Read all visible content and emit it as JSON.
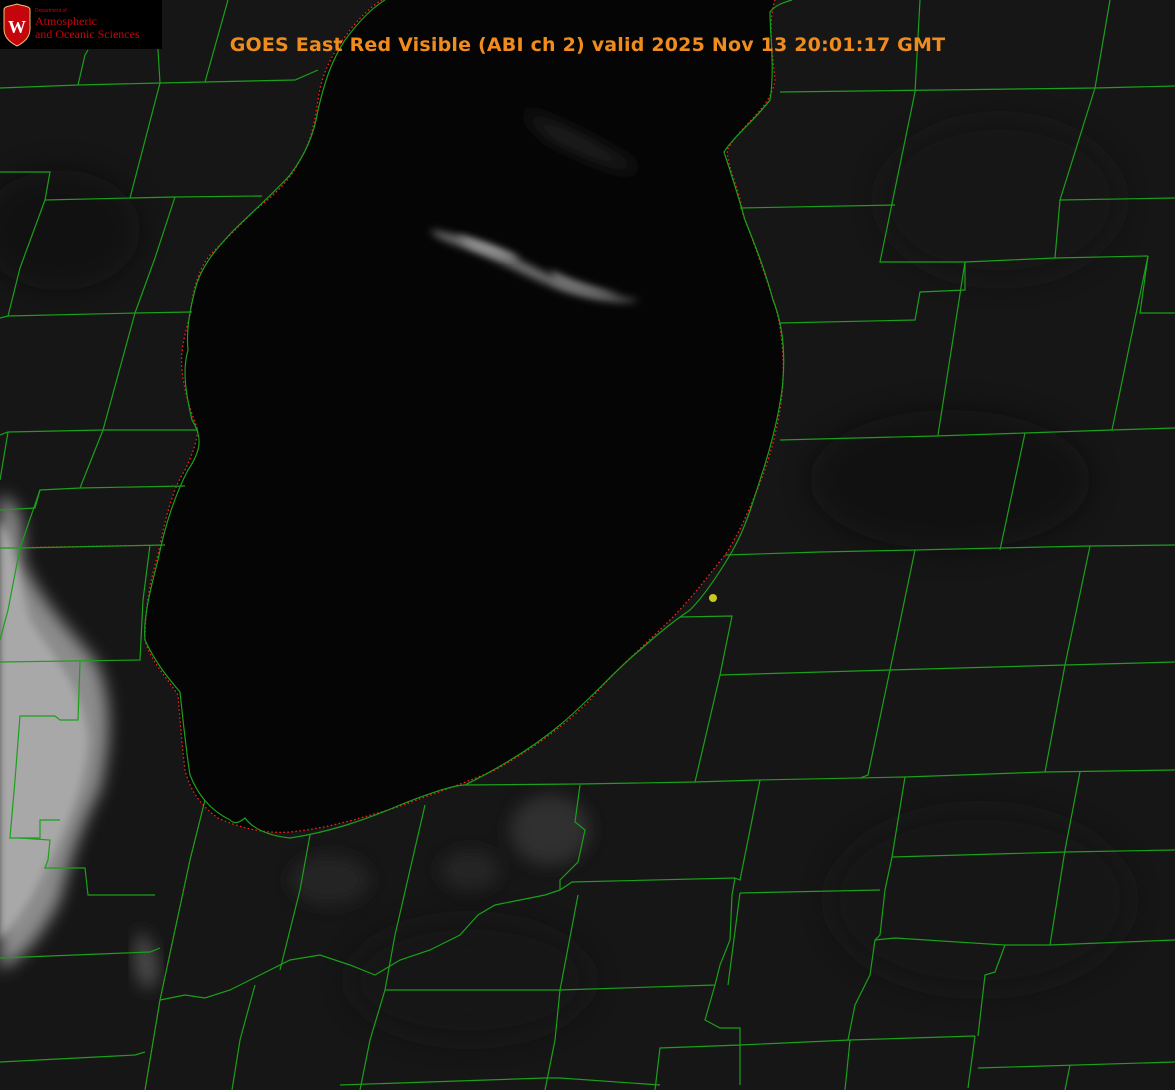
{
  "header": {
    "title": "GOES East Red Visible (ABI ch 2) valid 2025 Nov 13 20:01:17 GMT"
  },
  "logo": {
    "dept_label": "Department of",
    "line1": "Atmospheric",
    "line2": "and Oceanic Sciences",
    "crest_letter": "W"
  },
  "colors": {
    "title": "#f08c1e",
    "county_border": "#1aa01a",
    "coastline": "#ff2020",
    "marker": "#c8c820",
    "lake": "#050505",
    "land": "#161616",
    "cloud": "#9a9a9a",
    "logo_red": "#c5050c"
  },
  "map": {
    "imagery": "satellite-visible",
    "features": [
      "county-borders",
      "coastline",
      "station-marker",
      "cloud-bank-west"
    ]
  }
}
